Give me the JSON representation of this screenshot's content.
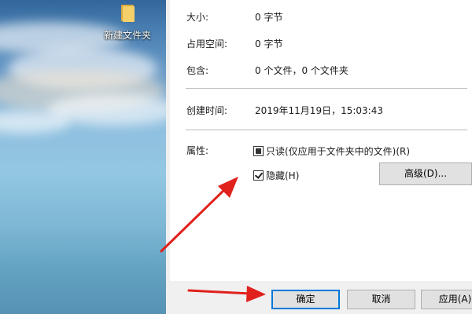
{
  "desktop": {
    "folder_icon_label": "新建文件夹"
  },
  "properties": {
    "size_label": "大小:",
    "size_value": "0 字节",
    "size_on_disk_label": "占用空间:",
    "size_on_disk_value": "0 字节",
    "contains_label": "包含:",
    "contains_value": "0 个文件，0 个文件夹",
    "created_label": "创建时间:",
    "created_value": "2019年11月19日，15:03:43",
    "attributes_label": "属性:",
    "readonly_label": "只读(仅应用于文件夹中的文件)(R)",
    "readonly_state": "indeterminate",
    "hidden_label": "隐藏(H)",
    "hidden_state": "checked",
    "advanced_button": "高级(D)..."
  },
  "buttons": {
    "ok": "确定",
    "cancel": "取消",
    "apply": "应用(A)"
  },
  "colors": {
    "annotation_arrow": "#e0211c",
    "default_button_border": "#0078d7"
  }
}
